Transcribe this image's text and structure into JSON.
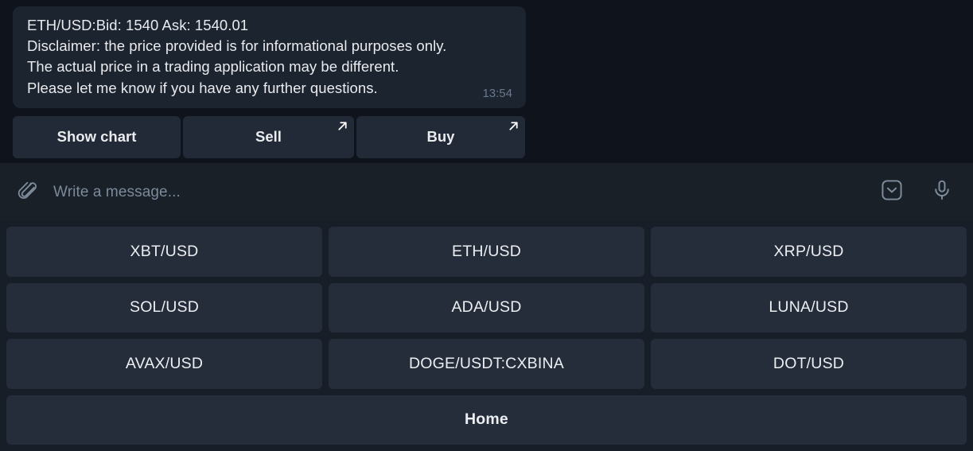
{
  "chat": {
    "message": {
      "lines": [
        "ETH/USD:Bid: 1540 Ask: 1540.01",
        "Disclaimer: the price provided is for informational purposes only.",
        "The actual price in a trading application may be different.",
        "Please let me know if you have any further questions."
      ],
      "time": "13:54"
    },
    "inline_buttons": [
      {
        "label": "Show chart",
        "icon": null
      },
      {
        "label": "Sell",
        "icon": "external-link-arrow-icon"
      },
      {
        "label": "Buy",
        "icon": "external-link-arrow-icon"
      }
    ]
  },
  "composer": {
    "attach_icon": "paperclip-icon",
    "placeholder": "Write a message...",
    "keyboard_toggle_icon": "chevron-down-box-icon",
    "voice_icon": "microphone-icon"
  },
  "keyboard": {
    "rows": [
      [
        {
          "label": "XBT/USD"
        },
        {
          "label": "ETH/USD"
        },
        {
          "label": "XRP/USD"
        }
      ],
      [
        {
          "label": "SOL/USD"
        },
        {
          "label": "ADA/USD"
        },
        {
          "label": "LUNA/USD"
        }
      ],
      [
        {
          "label": "AVAX/USD"
        },
        {
          "label": "DOGE/USDT:CXBINA"
        },
        {
          "label": "DOT/USD"
        }
      ],
      [
        {
          "label": "Home"
        }
      ]
    ]
  },
  "colors": {
    "chat_background": "#0f141c",
    "bubble_background": "#1c2430",
    "inline_button_background": "#212a36",
    "composer_background": "#1a2028",
    "keyboard_background": "#181e27",
    "keyboard_button_background": "#252d3b",
    "text_primary": "#e9ebee",
    "text_muted": "#7b8a9b",
    "timestamp": "#69798c"
  }
}
